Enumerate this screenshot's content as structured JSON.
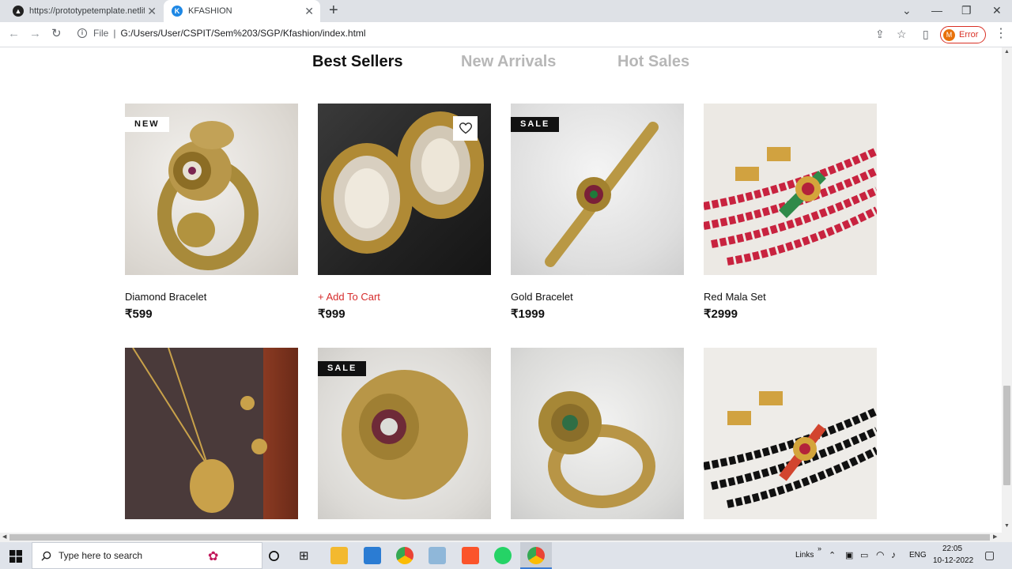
{
  "browser": {
    "tabs": [
      {
        "title": "https://prototypetemplate.netlify.app",
        "favicon": "netlify-icon",
        "active": false
      },
      {
        "title": "KFASHION",
        "favicon": "kfashion-icon",
        "active": true
      }
    ],
    "url_scheme": "File",
    "url": "G:/Users/User/CSPIT/Sem%203/SGP/Kfashion/index.html",
    "profile_initial": "M",
    "profile_status": "Error"
  },
  "page": {
    "filters": [
      {
        "label": "Best Sellers",
        "active": true
      },
      {
        "label": "New Arrivals",
        "active": false
      },
      {
        "label": "Hot Sales",
        "active": false
      }
    ],
    "products": [
      {
        "name": "Diamond Bracelet",
        "price": "₹599",
        "badge": "NEW",
        "image": "gold-bracelet-flower"
      },
      {
        "name": "+ Add To Cart",
        "price": "₹999",
        "badge": "",
        "heart": true,
        "image": "kundan-earrings"
      },
      {
        "name": "Gold Bracelet",
        "price": "₹1999",
        "badge": "SALE",
        "image": "gold-kada-bracelet"
      },
      {
        "name": "Red Mala Set",
        "price": "₹2999",
        "badge": "",
        "image": "red-mala-necklace"
      },
      {
        "name": "",
        "price": "",
        "badge": "",
        "image": "gold-chain-pendant"
      },
      {
        "name": "",
        "price": "",
        "badge": "SALE",
        "image": "gold-cuff-bracelet"
      },
      {
        "name": "",
        "price": "",
        "badge": "",
        "image": "gold-ring-bangle"
      },
      {
        "name": "",
        "price": "",
        "badge": "",
        "image": "black-mala-necklace"
      }
    ]
  },
  "taskbar": {
    "search_placeholder": "Type here to search",
    "links_label": "Links",
    "language": "ENG",
    "time": "22:05",
    "date": "10-12-2022"
  },
  "colors": {
    "accent_red": "#d62c2c",
    "filter_inactive": "#b7b7b7",
    "badge_dark": "#111111"
  }
}
